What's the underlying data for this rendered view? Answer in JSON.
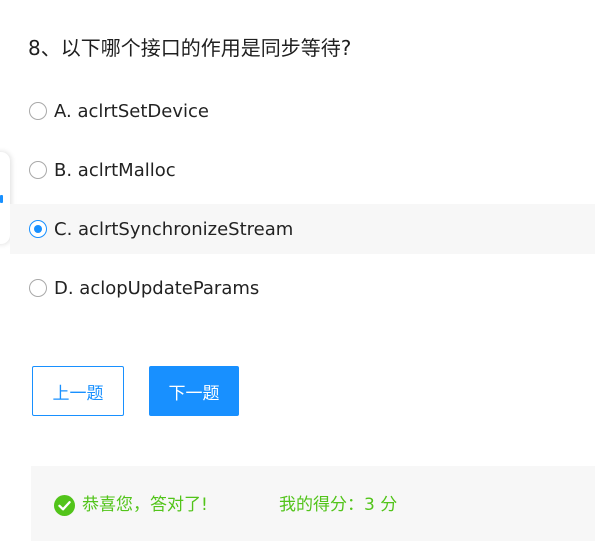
{
  "question": {
    "title": "8、以下哪个接口的作用是同步等待?"
  },
  "options": [
    {
      "label": "A. aclrtSetDevice",
      "selected": false
    },
    {
      "label": "B. aclrtMalloc",
      "selected": false
    },
    {
      "label": "C. aclrtSynchronizeStream",
      "selected": true
    },
    {
      "label": "D. aclopUpdateParams",
      "selected": false
    }
  ],
  "buttons": {
    "prev_label": "上一题",
    "next_label": "下一题"
  },
  "result": {
    "icon": "check-circle-icon",
    "message": "恭喜您，答对了!",
    "score_text": "我的得分：3 分"
  },
  "colors": {
    "accent": "#1890ff",
    "success": "#52c41a",
    "selected_row_bg": "#f7f7f7"
  }
}
